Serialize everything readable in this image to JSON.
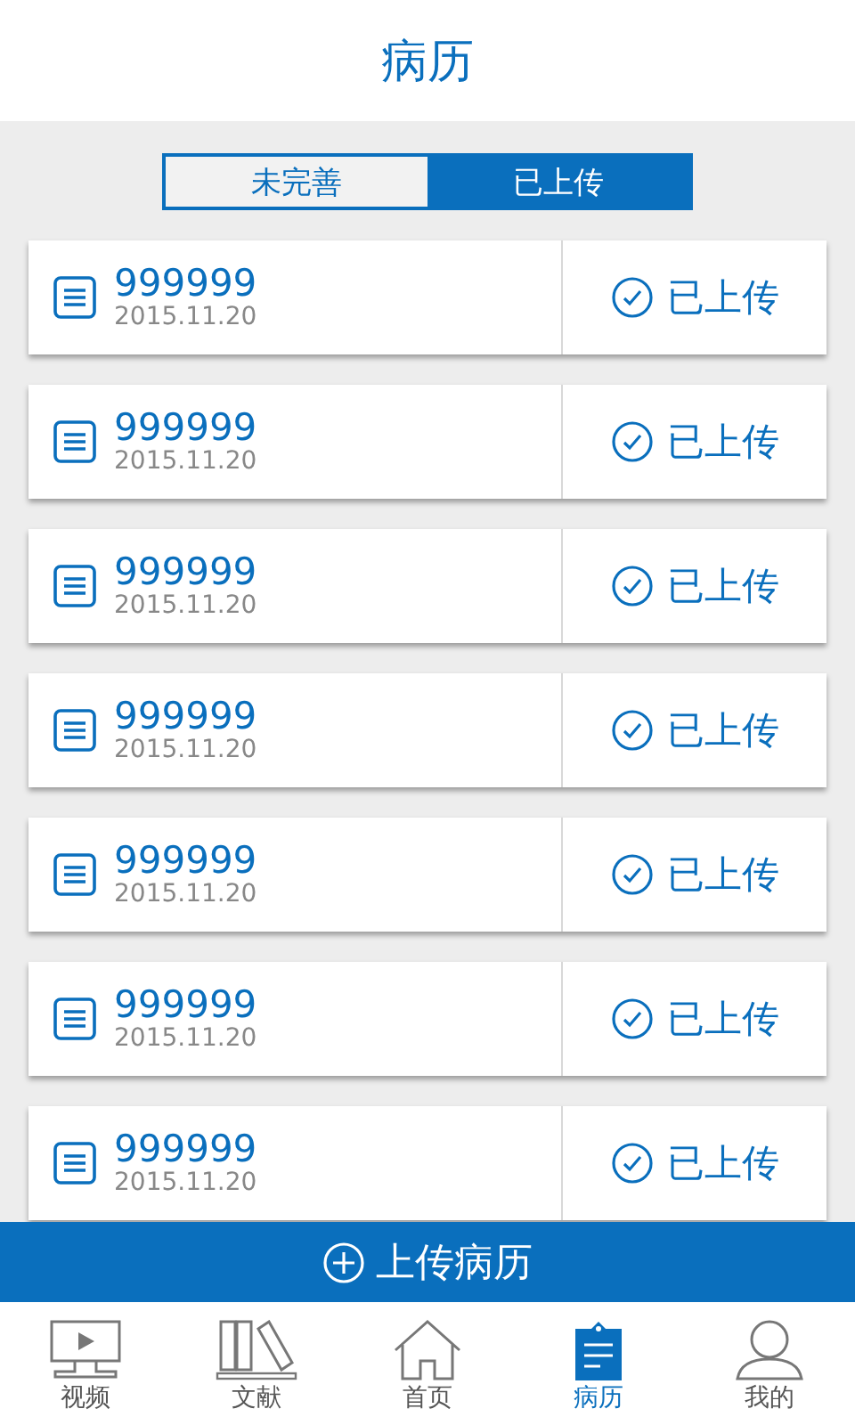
{
  "title": "病历",
  "tabs": [
    {
      "label": "未完善",
      "selected": false
    },
    {
      "label": "已上传",
      "selected": true
    }
  ],
  "records": [
    {
      "number": "999999",
      "date": "2015.11.20",
      "status": "已上传"
    },
    {
      "number": "999999",
      "date": "2015.11.20",
      "status": "已上传"
    },
    {
      "number": "999999",
      "date": "2015.11.20",
      "status": "已上传"
    },
    {
      "number": "999999",
      "date": "2015.11.20",
      "status": "已上传"
    },
    {
      "number": "999999",
      "date": "2015.11.20",
      "status": "已上传"
    },
    {
      "number": "999999",
      "date": "2015.11.20",
      "status": "已上传"
    },
    {
      "number": "999999",
      "date": "2015.11.20",
      "status": "已上传"
    }
  ],
  "upload_button": "上传病历",
  "nav": [
    {
      "label": "视频",
      "kind": "video",
      "selected": false
    },
    {
      "label": "文献",
      "kind": "books",
      "selected": false
    },
    {
      "label": "首页",
      "kind": "home",
      "selected": false
    },
    {
      "label": "病历",
      "kind": "record",
      "selected": true
    },
    {
      "label": "我的",
      "kind": "person",
      "selected": false
    }
  ]
}
